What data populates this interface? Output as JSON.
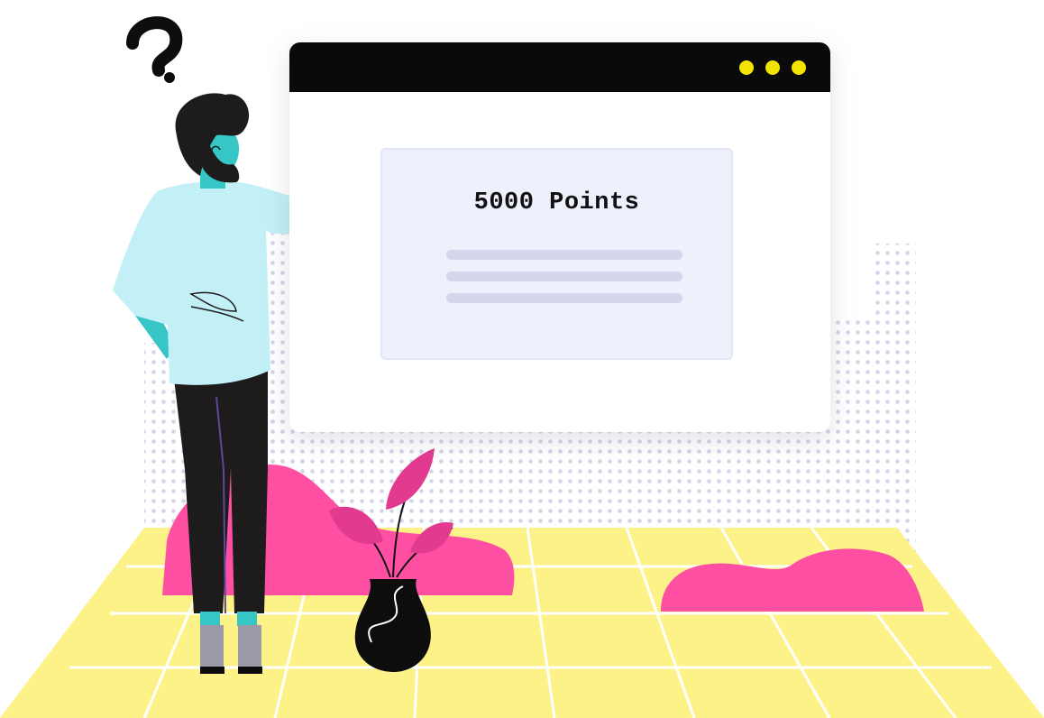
{
  "card": {
    "title": "5000 Points"
  },
  "colors": {
    "title_bar": "#0a0a0a",
    "window_dots": "#f2e400",
    "card_background": "#eef0fb",
    "placeholder_lines": "#d4d7ec",
    "floor": "#fdf287",
    "floor_grid": "#ffffff",
    "blob": "#ff4fa3",
    "dots_pattern": "#d4d4e8",
    "shirt": "#c2f0f6",
    "skin": "#36c6c6",
    "hair": "#1e1b1d",
    "pants": "#1e1b1d",
    "shoes": "#9c9aa6"
  },
  "icons": {
    "question_mark": "question-mark-icon",
    "window_controls": [
      "window-dot-icon",
      "window-dot-icon",
      "window-dot-icon"
    ]
  }
}
